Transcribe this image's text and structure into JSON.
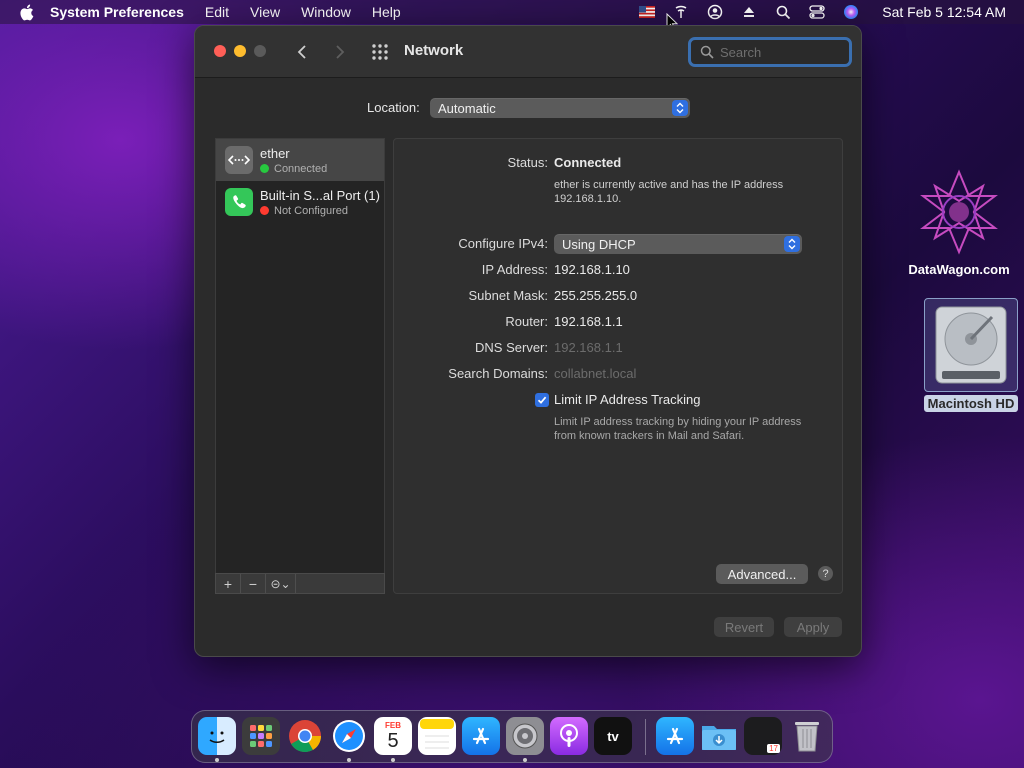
{
  "menubar": {
    "app_name": "System Preferences",
    "menus": [
      "Edit",
      "View",
      "Window",
      "Help"
    ],
    "clock": "Sat Feb 5  12:54 AM",
    "status_icons": [
      "flag-icon",
      "wifi-icon",
      "user-icon",
      "eject-icon",
      "search-icon",
      "control-center-icon",
      "siri-icon"
    ]
  },
  "window": {
    "title": "Network",
    "search_placeholder": "Search",
    "location_label": "Location:",
    "location_value": "Automatic"
  },
  "services": [
    {
      "name": "ether",
      "status": "Connected",
      "status_color": "#27c93f",
      "icon": "ethernet-icon"
    },
    {
      "name": "Built-in S...al Port (1)",
      "status": "Not Configured",
      "status_color": "#ff3b30",
      "icon": "phone-icon"
    }
  ],
  "list_tools": {
    "add": "+",
    "remove": "−",
    "more": "⊝⌄"
  },
  "detail": {
    "status_label": "Status:",
    "status_value": "Connected",
    "status_desc_1": "ether is currently active and has the IP address",
    "status_desc_2": "192.168.1.10.",
    "configure_label": "Configure IPv4:",
    "configure_value": "Using DHCP",
    "ip_label": "IP Address:",
    "ip_value": "192.168.1.10",
    "subnet_label": "Subnet Mask:",
    "subnet_value": "255.255.255.0",
    "router_label": "Router:",
    "router_value": "192.168.1.1",
    "dns_label": "DNS Server:",
    "dns_value": "192.168.1.1",
    "domains_label": "Search Domains:",
    "domains_value": "collabnet.local",
    "limit_label": "Limit IP Address Tracking",
    "limit_checked": true,
    "limit_desc_1": "Limit IP address tracking by hiding your IP address",
    "limit_desc_2": "from known trackers in Mail and Safari.",
    "advanced_label": "Advanced...",
    "help_label": "?"
  },
  "footer": {
    "revert_label": "Revert",
    "apply_label": "Apply"
  },
  "desktop": {
    "datawagon_label": "DataWagon.com",
    "hd_label": "Macintosh HD"
  },
  "dock": {
    "calendar_month": "FEB",
    "calendar_day": "5",
    "tv_label": "tv",
    "mini_badge": "17"
  },
  "colors": {
    "accent": "#2f6fe0",
    "close": "#ff5f57",
    "minimize": "#febc2e"
  }
}
